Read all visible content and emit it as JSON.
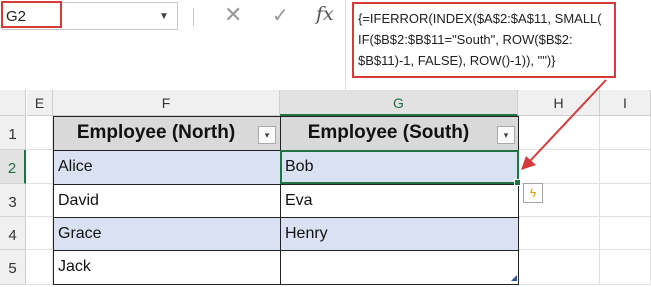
{
  "name_box": {
    "value": "G2"
  },
  "formula_bar": {
    "cancel_icon": "✕",
    "enter_icon": "✓",
    "fx_label": "fx",
    "formula": "{=IFERROR(INDEX($A$2:$A$11, SMALL(\nIF($B$2:$B$11=\"South\", ROW($B$2:\n$B$11)-1, FALSE), ROW()-1)), \"\")}"
  },
  "columns": [
    "E",
    "F",
    "G",
    "H",
    "I"
  ],
  "rows": [
    "1",
    "2",
    "3",
    "4",
    "5"
  ],
  "table": {
    "headers": [
      "Employee (North)",
      "Employee (South)"
    ],
    "filter_glyph": "▾",
    "rows": [
      [
        "Alice",
        "Bob"
      ],
      [
        "David",
        "Eva"
      ],
      [
        "Grace",
        "Henry"
      ],
      [
        "Jack",
        ""
      ]
    ]
  },
  "colors": {
    "accent_green": "#217346",
    "highlight_red": "#d63a3a",
    "band_blue": "#d9e1f2",
    "header_gray": "#d9d9d9"
  }
}
